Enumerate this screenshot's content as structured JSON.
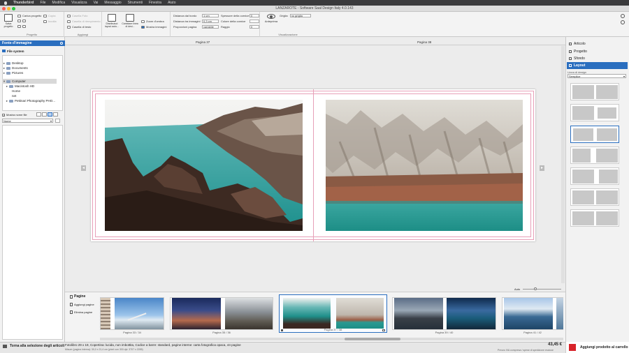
{
  "macbar": {
    "apple": "",
    "menus": [
      "Thunderbird",
      "File",
      "Modifica",
      "Visualizza",
      "Vai",
      "Messaggio",
      "Strumenti",
      "Finestra",
      "Aiuto"
    ]
  },
  "window": {
    "title": "LANZAROTE - Software Saal Design Italy 4.0.143"
  },
  "ribbon": {
    "progetto": {
      "label": "Progetto",
      "salva": "Salva progetto",
      "carica": "Carica progetto",
      "copia": "Copia",
      "incolla": "Incolla"
    },
    "aggiungi": {
      "label": "Aggiungi",
      "casella_foto": "Casella Foto",
      "casella_riempimento": "Casella di riempimento",
      "casella_testo": "Casella di testo"
    },
    "layout": {
      "distribuisci": "Distribuisci layout auto...",
      "cambia": "Cambiare linea di desi...",
      "zoom": "Zoom d'ombra",
      "mostra": "Mostra immagini"
    },
    "misure": {
      "dist_bordo": "Distanza dal bordo",
      "dist_bordo_val": "1 cm",
      "dist_immagini": "Distanza tra immagini",
      "dist_immagini_val": "0,3 cm",
      "proporzioni": "Proporzioni pagina",
      "proporzioni_val": "variabile",
      "spessore": "Spessore della cornice",
      "spessore_val": "0",
      "colore": "Colore della cornice",
      "raggio": "Raggio",
      "raggio_val": "0"
    },
    "visualizzazione": {
      "label": "Visualizzazione",
      "anteprima": "Anteprima",
      "griglia": "Griglia",
      "griglia_val": "no griglia"
    }
  },
  "left": {
    "header": "Fonte d'immagine",
    "tab": "File system",
    "tree": [
      "Desktop",
      "Documents",
      "Pictures",
      "Computer",
      "Macintosh HD",
      "Home",
      "net",
      "Pettinari Photography PHO..."
    ],
    "mostra_nome": "Mostra nome file",
    "sort": "Nome"
  },
  "canvas": {
    "page_left": "Pagina 37",
    "page_right": "Pagina 38"
  },
  "right": {
    "items": [
      "Articolo",
      "Progetto",
      "Sfondo",
      "Layout"
    ],
    "linea_label": "Linea di design",
    "linea_val": "Semplice"
  },
  "filmstrip": {
    "title": "Pagine",
    "add": "Aggiungi pagine",
    "del": "Elimina pagine",
    "zoom_label": "Auto",
    "captions": [
      "Pagina 33 / 34",
      "Pagina 35 / 36",
      "Pagina 37 / 38",
      "Pagina 39 / 40",
      "Pagina 41 / 42"
    ]
  },
  "status": {
    "back": "Torna alla selezione degli articoli",
    "line1": "Fotolibro 29 x 19, Copertina: lucida, non imbottita, Codice a barre: standard, pagine interne: carta fotografica opaca, 44 pagine",
    "line2": "Misure (pagina interna): 30,0 x 21,4 cm (pixel con 300 dpi: 3707 x 2285)",
    "price": "43,45 €",
    "price_note": "Prezzo IVA compresa / spese di spedizione escluse",
    "cart": "Aggiungi prodotto al carrello"
  },
  "colors": {
    "accent": "#2a6ebf",
    "red": "#d8232a"
  }
}
